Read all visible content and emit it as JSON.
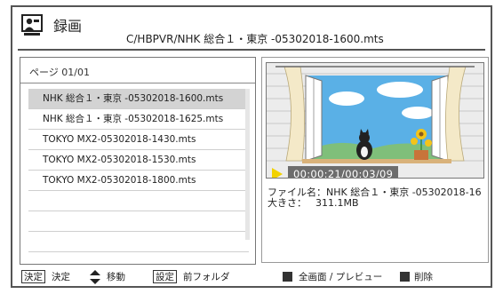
{
  "header": {
    "title": "録画",
    "path": "C/HBPVR/NHK 総合１・東京 -05302018-1600.mts"
  },
  "list": {
    "page_indicator": "ページ  01/01",
    "files": [
      "NHK 総合１・東京 -05302018-1600.mts",
      "NHK 総合１・東京 -05302018-1625.mts",
      "TOKYO   MX2-05302018-1430.mts",
      "TOKYO   MX2-05302018-1530.mts",
      "TOKYO   MX2-05302018-1800.mts"
    ],
    "selected_index": 0
  },
  "preview": {
    "time": "00:00:21/00:03/09",
    "info_line1": "ファイル名：NHK 総合１・東京 -05302018-16",
    "info_size_label": "大きさ：",
    "info_size_value": "311.1MB"
  },
  "footer": {
    "ok_key": "決定",
    "ok_label": "決定",
    "move_label": "移動",
    "settings_key": "設定",
    "prev_folder_label": "前フォルダ",
    "fullscreen_label": "全画面 / プレビュー",
    "delete_label": "削除"
  },
  "icons": {
    "record": "record-camera-icon",
    "updown": "up-down-arrows-icon",
    "play": "play-marker-icon"
  },
  "colors": {
    "selected_row": "#d3d3d3",
    "play_marker": "#f2d200",
    "sky": "#5ab0e6",
    "border": "#555555"
  }
}
